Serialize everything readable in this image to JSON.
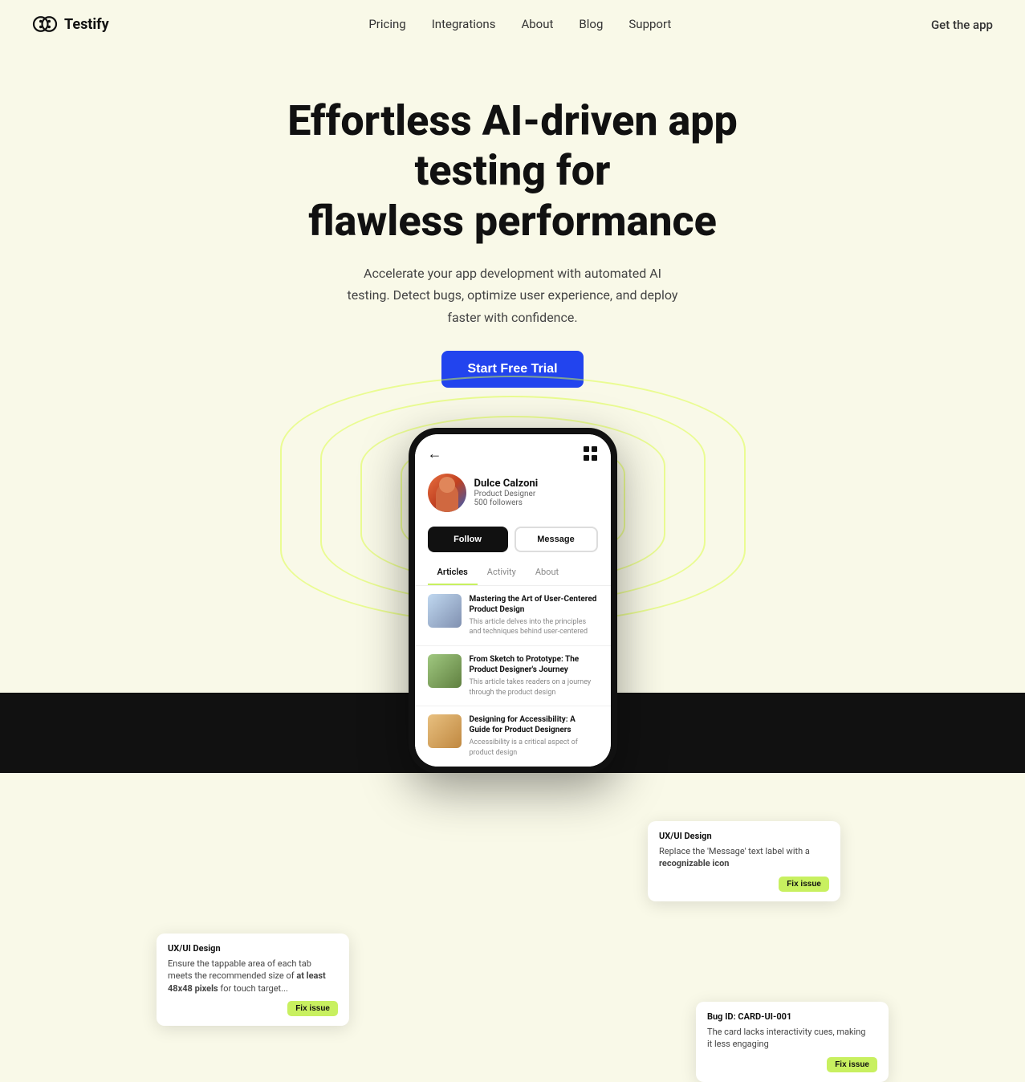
{
  "nav": {
    "logo_text": "Testify",
    "links": [
      {
        "label": "Pricing",
        "id": "pricing"
      },
      {
        "label": "Integrations",
        "id": "integrations"
      },
      {
        "label": "About",
        "id": "about"
      },
      {
        "label": "Blog",
        "id": "blog"
      },
      {
        "label": "Support",
        "id": "support"
      }
    ],
    "cta": "Get the app"
  },
  "hero": {
    "title_line1": "Effortless AI-driven app testing for",
    "title_line2": "flawless performance",
    "description": "Accelerate your app development with automated AI testing. Detect bugs, optimize user experience, and deploy faster with confidence.",
    "cta_button": "Start Free Trial"
  },
  "phone": {
    "profile_name": "Dulce Calzoni",
    "profile_title": "Product Designer",
    "profile_followers": "500 followers",
    "btn_follow": "Follow",
    "btn_message": "Message",
    "tabs": [
      {
        "label": "Articles",
        "active": true
      },
      {
        "label": "Activity",
        "active": false
      },
      {
        "label": "About",
        "active": false
      }
    ],
    "articles": [
      {
        "title": "Mastering the Art of User-Centered Product Design",
        "desc": "This article delves into the principles and techniques behind user-centered",
        "thumb_class": "thumb-1"
      },
      {
        "title": "From Sketch to Prototype: The Product Designer's Journey",
        "desc": "This article takes readers on a journey through the product design",
        "thumb_class": "thumb-2"
      },
      {
        "title": "Designing for Accessibility: A Guide for Product Designers",
        "desc": "Accessibility is a critical aspect of product design",
        "thumb_class": "thumb-3"
      }
    ]
  },
  "tooltip_cards": [
    {
      "id": "card-top-right",
      "category": "UX/UI Design",
      "text": "Replace the 'Message' text label with a ",
      "bold_text": "recognizable icon",
      "fix_label": "Fix issue"
    },
    {
      "id": "card-bottom-left",
      "category": "UX/UI Design",
      "text": "Ensure the tappable area of each tab meets the recommended size of ",
      "bold_text": "at least 48x48 pixels",
      "text2": " for touch target...",
      "fix_label": "Fix issue"
    },
    {
      "id": "card-bottom-right",
      "category": "Bug ID: CARD-UI-001",
      "text": "The card lacks interactivity cues, making it less engaging",
      "fix_label": "Fix issue"
    }
  ]
}
